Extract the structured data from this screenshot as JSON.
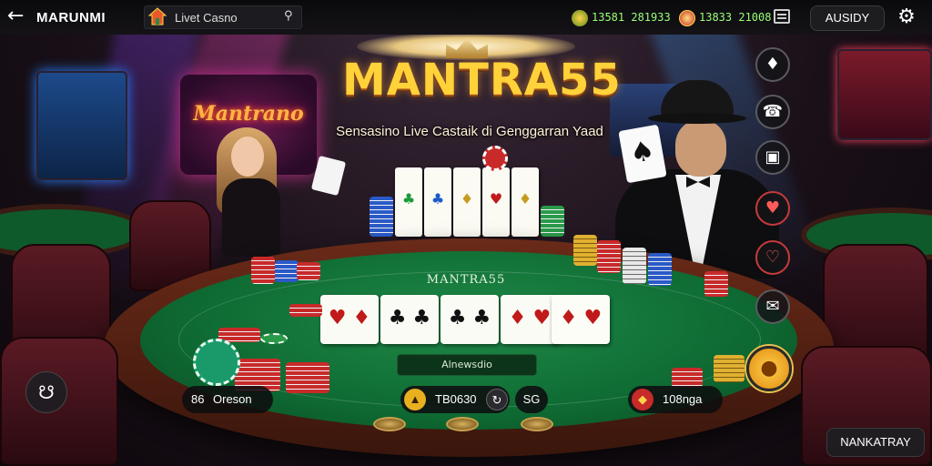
{
  "topbar": {
    "app_name": "MARUNMI",
    "search_text": "Livet Casno",
    "balance_1": "13581 281933",
    "balance_2": "13833 21008",
    "right_button": "AUSIDY"
  },
  "hero": {
    "title": "MANTRA55",
    "subtitle": "Sensasino Live Castaik di Genggarran Yaad",
    "neon_sign": "Mantrano"
  },
  "table": {
    "felt_logo": "MANTRA55",
    "info_text": "Alnewsdio",
    "cards": [
      "♥ ♦",
      "♣ ♣",
      "♣ ♣",
      "♦ ♥",
      "♦ ♥"
    ]
  },
  "hud": {
    "left_label": "Oreson",
    "left_count": "86",
    "center_value": "TB0630",
    "center_badge": "SG",
    "right_value": "108nga",
    "bottom_right_button": "NANKATRAY"
  },
  "colors": {
    "title_gold": "#ffd23a",
    "felt_green": "#1f8a48",
    "balance_green": "#9aff7a"
  },
  "icons": [
    "back-arrow-icon",
    "house-icon",
    "search-icon",
    "coin-icon",
    "menu-icon",
    "gear-icon",
    "chip-icon",
    "support-icon",
    "gift-icon",
    "heart-icon",
    "chat-icon",
    "mic-icon"
  ]
}
